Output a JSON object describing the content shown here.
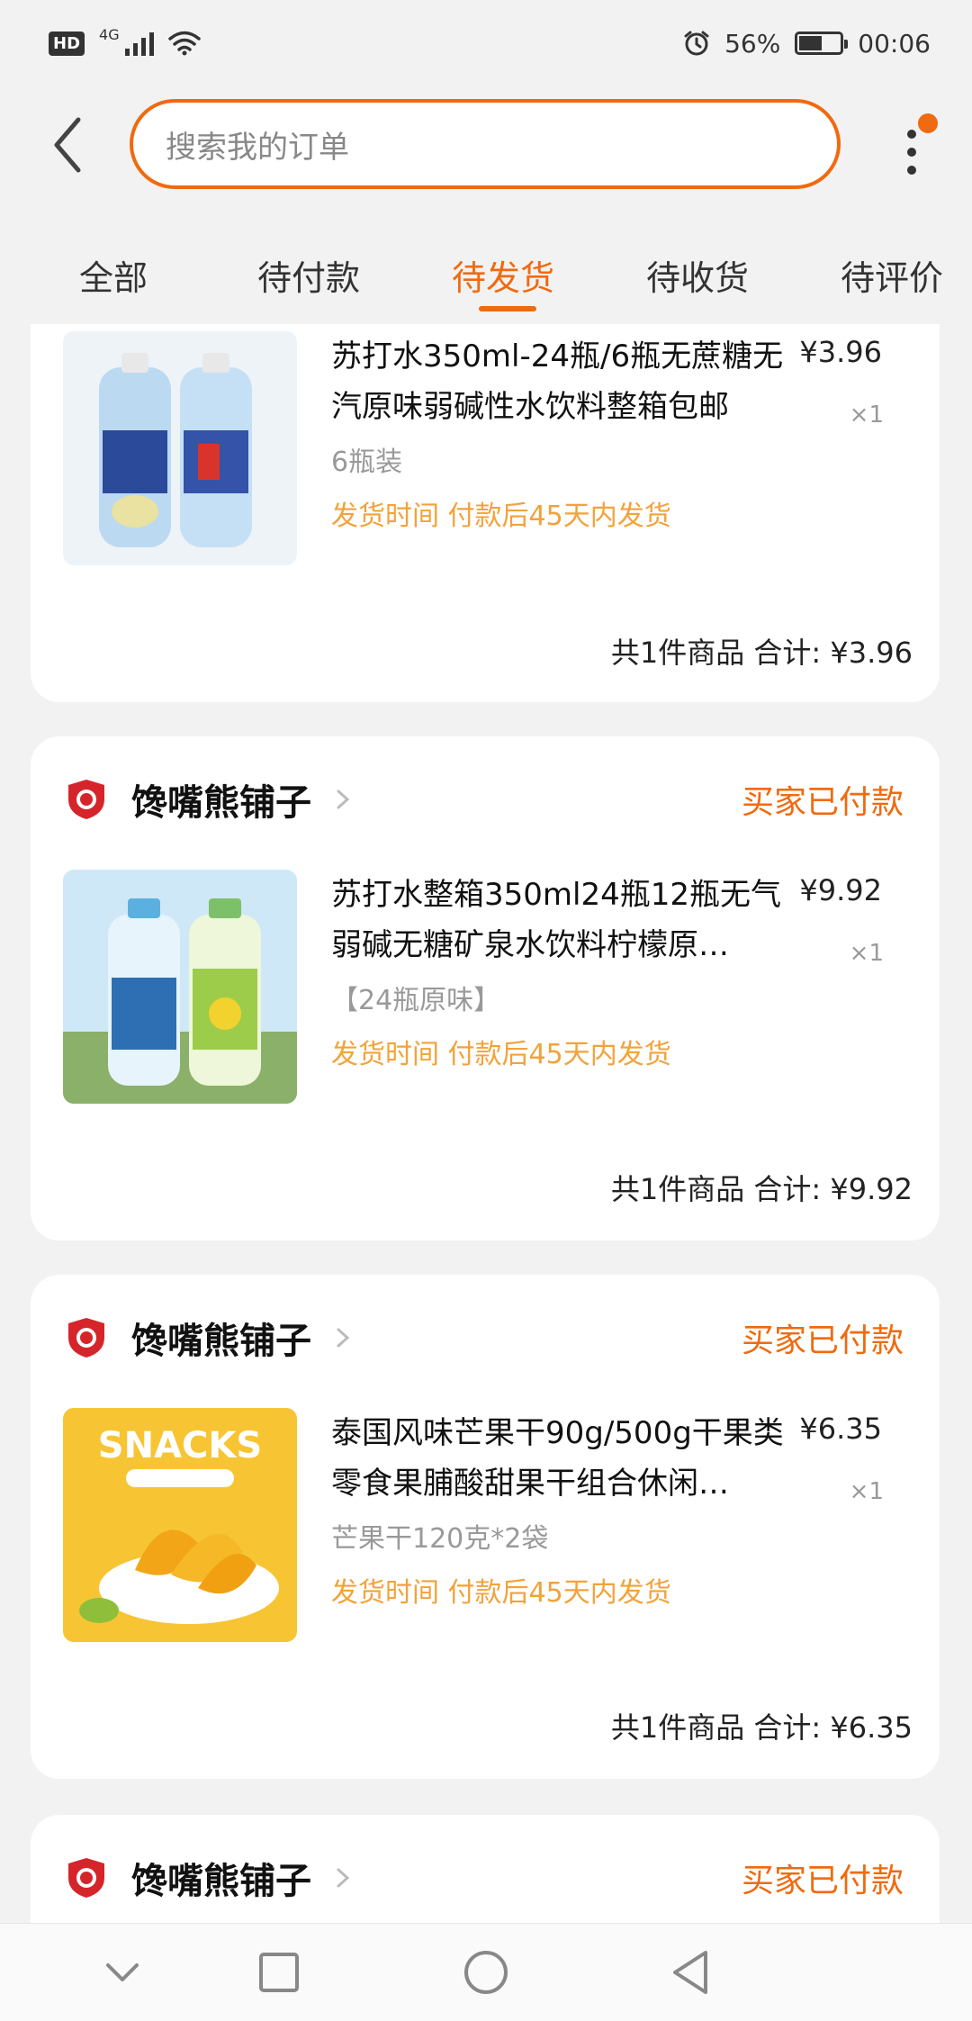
{
  "status_bar": {
    "hd": "HD",
    "network": "4G",
    "battery_percent": "56%",
    "battery_level": 0.56,
    "time": "00:06"
  },
  "search": {
    "placeholder": "搜索我的订单"
  },
  "tabs": [
    {
      "label": "全部"
    },
    {
      "label": "待付款"
    },
    {
      "label": "待发货"
    },
    {
      "label": "待收货"
    },
    {
      "label": "待评价"
    }
  ],
  "active_tab_index": 2,
  "orders": [
    {
      "shop": "",
      "status": "",
      "product": {
        "title": "苏打水350ml-24瓶/6瓶无蔗糖无汽原味弱碱性水饮料整箱包邮",
        "spec": "6瓶装",
        "shipping": "发货时间 付款后45天内发货",
        "price": "¥3.96",
        "qty": "×1"
      },
      "summary": "共1件商品 合计: ¥3.96"
    },
    {
      "shop": "馋嘴熊铺子",
      "status": "买家已付款",
      "product": {
        "title": "苏打水整箱350ml24瓶12瓶无气弱碱无糖矿泉水饮料柠檬原…",
        "spec": "【24瓶原味】",
        "shipping": "发货时间 付款后45天内发货",
        "price": "¥9.92",
        "qty": "×1"
      },
      "summary": "共1件商品 合计: ¥9.92"
    },
    {
      "shop": "馋嘴熊铺子",
      "status": "买家已付款",
      "product": {
        "title": "泰国风味芒果干90g/500g干果类零食果脯酸甜果干组合休闲…",
        "spec": "芒果干120克*2袋",
        "shipping": "发货时间 付款后45天内发货",
        "price": "¥6.35",
        "qty": "×1",
        "image_text": "SNACKS"
      },
      "summary": "共1件商品 合计: ¥6.35"
    },
    {
      "shop": "馋嘴熊铺子",
      "status": "买家已付款"
    }
  ],
  "colors": {
    "accent": "#f06a0f",
    "shipping_text": "#f3a23a",
    "background": "#f2f2f2"
  },
  "icons": {
    "back": "chevron-left-icon",
    "more": "more-vertical-icon",
    "shop": "shop-badge-icon",
    "nav": [
      "chevron-down-icon",
      "square-icon",
      "circle-icon",
      "triangle-back-icon"
    ]
  }
}
